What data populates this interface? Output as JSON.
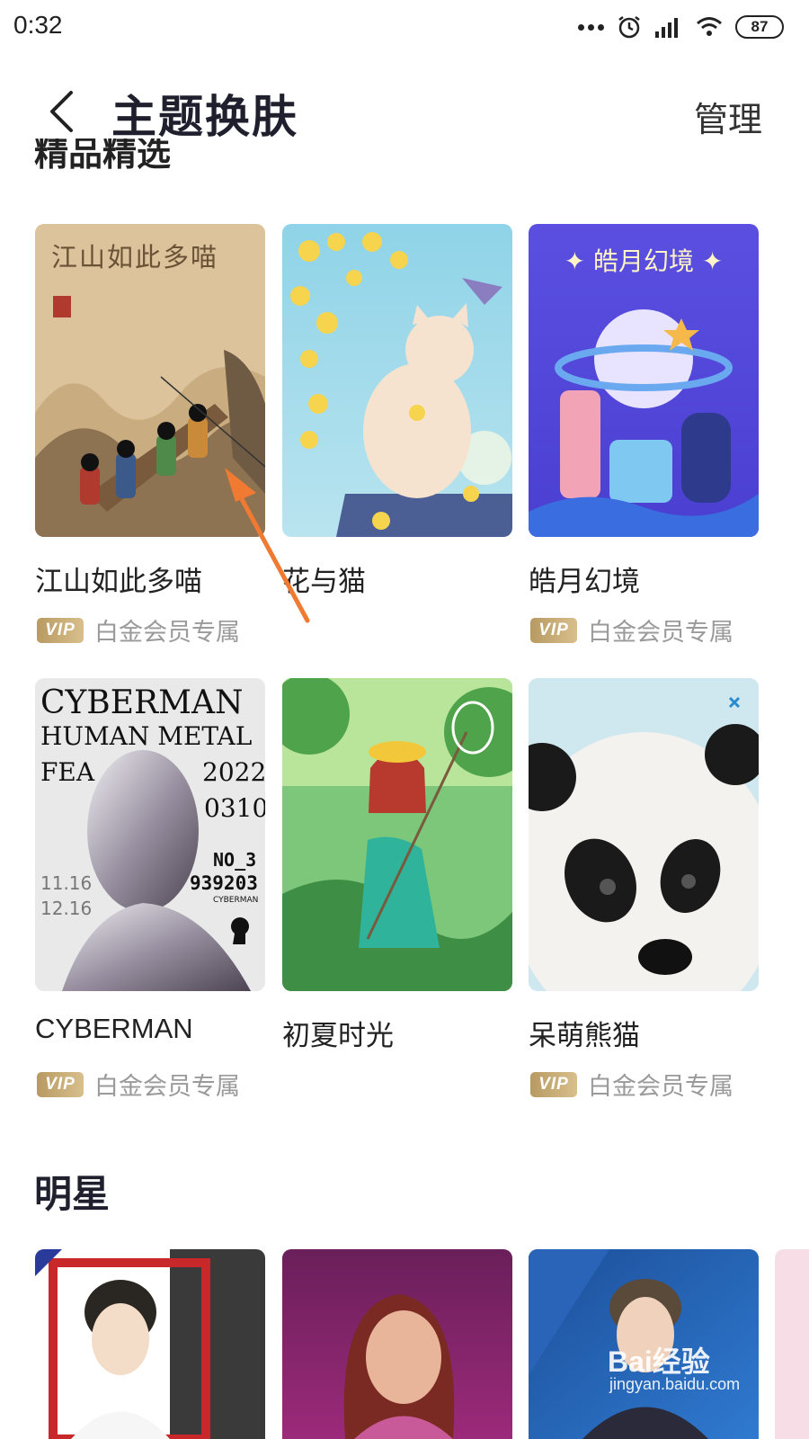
{
  "status_bar": {
    "time": "0:32",
    "battery": "87"
  },
  "header": {
    "title": "主题换肤",
    "manage_label": "管理",
    "partial_section_title": "精品精选"
  },
  "themes_row1": [
    {
      "name": "江山如此多喵",
      "vip": true,
      "poster_title": "江山如此多喵"
    },
    {
      "name": "花与猫",
      "vip": false
    },
    {
      "name": "皓月幻境",
      "vip": true,
      "poster_title": "✦ 皓月幻境 ✦"
    }
  ],
  "themes_row2": [
    {
      "name": "CYBERMAN",
      "vip": true,
      "poster_lines": [
        "CYBERMAN",
        "HUMAN METAL",
        "FEA",
        "2022",
        "0310",
        "NO_3",
        "939203",
        "11.16",
        "12.16",
        "CYBERMAN"
      ]
    },
    {
      "name": "初夏时光",
      "vip": false
    },
    {
      "name": "呆萌熊猫",
      "vip": true
    }
  ],
  "vip_badge": "VIP",
  "vip_text": "白金会员专属",
  "star_section": {
    "title": "明星"
  },
  "watermark": {
    "brand": "Bai经验",
    "url": "jingyan.baidu.com"
  }
}
